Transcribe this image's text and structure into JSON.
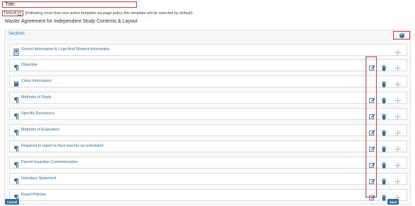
{
  "form": {
    "title_label": "Title:",
    "default_label": "Default",
    "default_note": "(Following more than one active template via page policy this template will be selected by default)",
    "page_title": "Master Agreement for Independent Study Contents & Layout"
  },
  "sections": {
    "header": "Sections",
    "items": [
      {
        "label": "School Information & Logo And Student Information",
        "icon": "school-info-icon"
      },
      {
        "label": "Objective",
        "icon": "paragraph-icon"
      },
      {
        "label": "Class Information",
        "icon": "book-icon"
      },
      {
        "label": "Methods of Study",
        "icon": "paragraph-icon"
      },
      {
        "label": "Specific Resources",
        "icon": "paragraph-icon"
      },
      {
        "label": "Methods of Evaluation",
        "icon": "paragraph-icon"
      },
      {
        "label": "Required to report to their teacher as scheduled",
        "icon": "paragraph-icon"
      },
      {
        "label": "Parent Guardian Communication",
        "icon": "paragraph-icon"
      },
      {
        "label": "Voluntary Statement",
        "icon": "paragraph-icon"
      },
      {
        "label": "Board Policies",
        "icon": "paragraph-icon"
      }
    ]
  },
  "buttons": {
    "cancel": "Cancel",
    "save": "Save"
  },
  "colors": {
    "accent": "#2e6da4",
    "highlight": "#e53935"
  }
}
